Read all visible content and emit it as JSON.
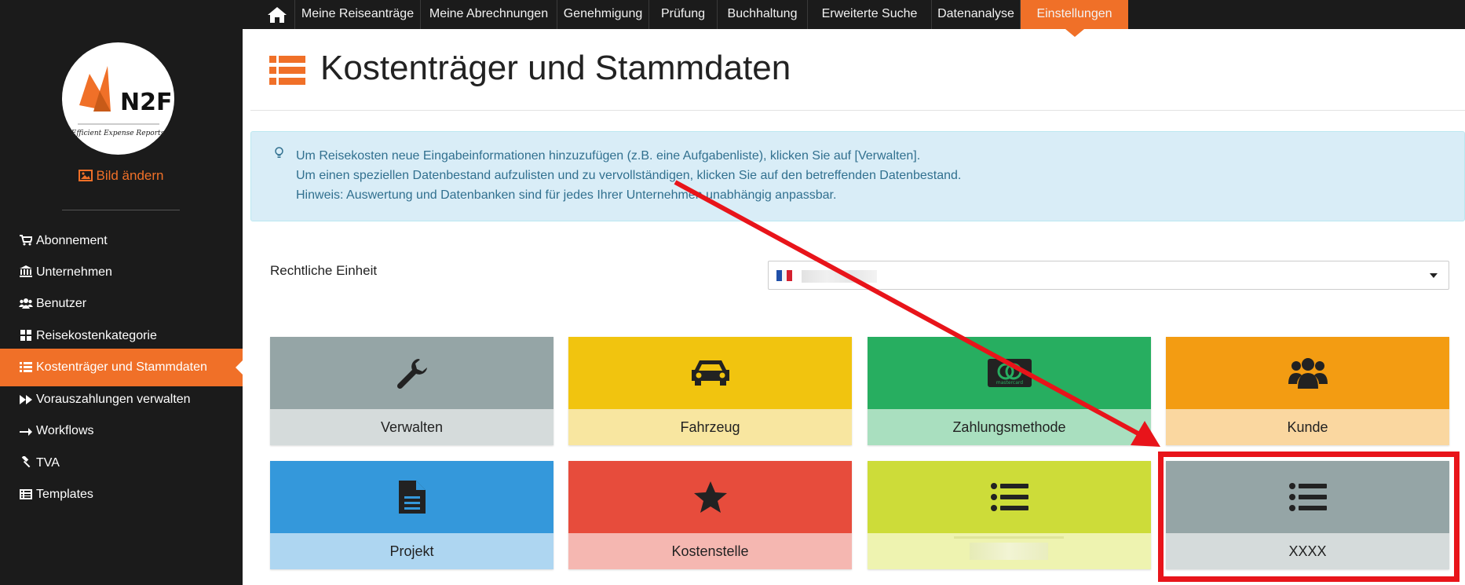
{
  "topnav": {
    "home_icon": "home-icon",
    "items": [
      {
        "label": "Meine Reiseanträge"
      },
      {
        "label": "Meine Abrechnungen"
      },
      {
        "label": "Genehmigung"
      },
      {
        "label": "Prüfung"
      },
      {
        "label": "Buchhaltung"
      },
      {
        "label": "Erweiterte Suche"
      },
      {
        "label": "Datenanalyse"
      },
      {
        "label": "Einstellungen",
        "active": true
      }
    ]
  },
  "sidebar": {
    "logo": {
      "brand": "N2F",
      "tagline": "Efficient Expense Reports"
    },
    "change_picture_label": "Bild ändern",
    "items": [
      {
        "label": "Abonnement",
        "icon": "cart-icon"
      },
      {
        "label": "Unternehmen",
        "icon": "bank-icon"
      },
      {
        "label": "Benutzer",
        "icon": "users-icon"
      },
      {
        "label": "Reisekostenkategorie",
        "icon": "grid-icon"
      },
      {
        "label": "Kostenträger und Stammdaten",
        "icon": "list-icon",
        "active": true
      },
      {
        "label": "Vorauszahlungen verwalten",
        "icon": "fast-forward-icon"
      },
      {
        "label": "Workflows",
        "icon": "arrow-right-icon"
      },
      {
        "label": "TVA",
        "icon": "gavel-icon"
      },
      {
        "label": "Templates",
        "icon": "list-alt-icon"
      }
    ]
  },
  "page": {
    "title": "Kostenträger und Stammdaten",
    "info_lines": [
      "Um Reisekosten neue Eingabeinformationen hinzuzufügen (z.B. eine Aufgabenliste), klicken Sie auf [Verwalten].",
      "Um einen speziellen Datenbestand aufzulisten und zu vervollständigen, klicken Sie auf den betreffenden Datenbestand.",
      "Hinweis: Auswertung und Datenbanken sind für jedes Ihrer Unternehmen unabhängig anpassbar."
    ],
    "legal_entity_label": "Rechtliche Einheit",
    "legal_entity_flag": "fr-flag-icon"
  },
  "tiles": [
    {
      "label": "Verwalten",
      "icon": "wrench-icon",
      "top_color": "#95a5a6",
      "bottom_color": "#d5dbdb"
    },
    {
      "label": "Fahrzeug",
      "icon": "car-icon",
      "top_color": "#f1c40f",
      "bottom_color": "#f8e6a0"
    },
    {
      "label": "Zahlungsmethode",
      "icon": "credit-card-icon",
      "card_text": "mastercard",
      "top_color": "#27ae60",
      "bottom_color": "#a9dfbf"
    },
    {
      "label": "Kunde",
      "icon": "users-icon",
      "top_color": "#f39c12",
      "bottom_color": "#fad7a0"
    },
    {
      "label": "Projekt",
      "icon": "file-icon",
      "top_color": "#3498db",
      "bottom_color": "#aed6f1"
    },
    {
      "label": "Kostenstelle",
      "icon": "star-icon",
      "top_color": "#e74c3c",
      "bottom_color": "#f5b7b1"
    },
    {
      "label": "",
      "icon": "list-icon",
      "top_color": "#cddc39",
      "bottom_color": "#eef3b0"
    },
    {
      "label": "XXXX",
      "icon": "list-icon",
      "top_color": "#95a5a6",
      "bottom_color": "#d5dbdb"
    }
  ],
  "annotation": {
    "highlight_color": "#e8141a"
  }
}
